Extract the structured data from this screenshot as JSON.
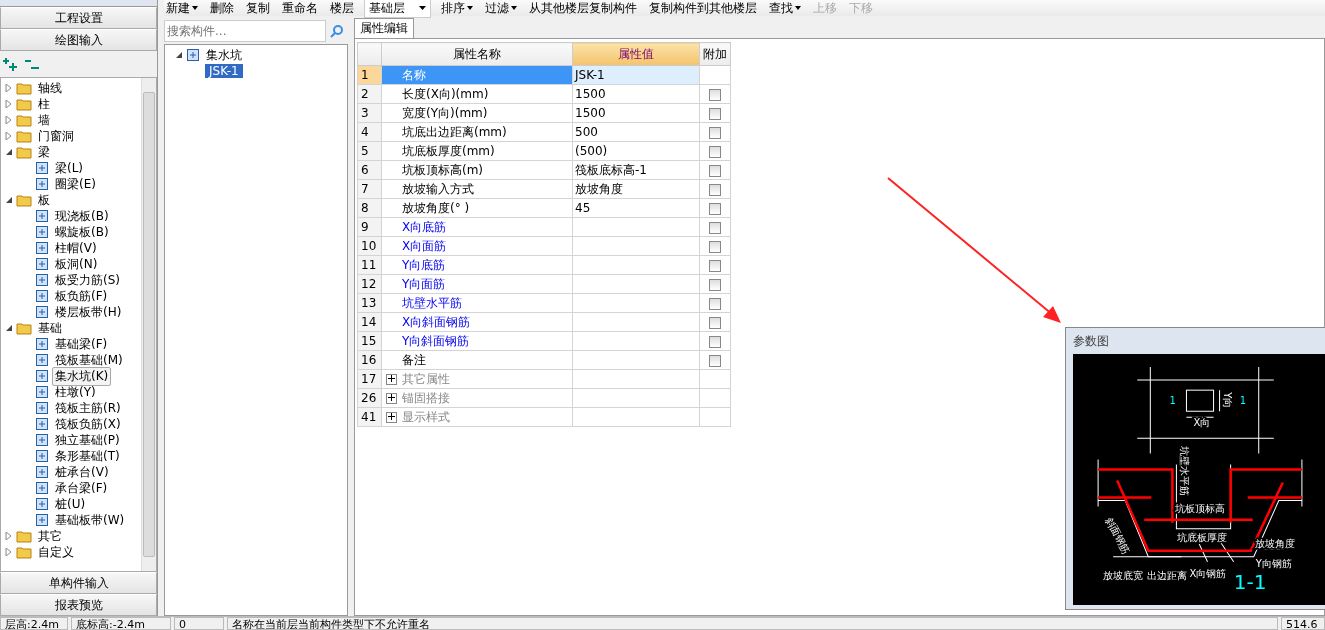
{
  "toolbar": [
    {
      "kind": "button",
      "label": "新建",
      "caret": true,
      "disabled": false
    },
    {
      "kind": "button",
      "label": "删除",
      "caret": false,
      "disabled": false
    },
    {
      "kind": "button",
      "label": "复制",
      "caret": false,
      "disabled": false
    },
    {
      "kind": "button",
      "label": "重命名",
      "caret": false,
      "disabled": false
    },
    {
      "kind": "select",
      "label": "楼层",
      "value": "基础层"
    },
    {
      "kind": "button",
      "label": "排序",
      "caret": true,
      "disabled": false
    },
    {
      "kind": "button",
      "label": "过滤",
      "caret": true,
      "disabled": false
    },
    {
      "kind": "button",
      "label": "从其他楼层复制构件",
      "caret": false,
      "disabled": false
    },
    {
      "kind": "button",
      "label": "复制构件到其他楼层",
      "caret": false,
      "disabled": false
    },
    {
      "kind": "button",
      "label": "查找",
      "caret": true,
      "disabled": false
    },
    {
      "kind": "button",
      "label": "上移",
      "caret": false,
      "disabled": true
    },
    {
      "kind": "button",
      "label": "下移",
      "caret": false,
      "disabled": true
    }
  ],
  "nav": {
    "top_buttons": [
      "工程设置",
      "绘图输入"
    ],
    "tree": [
      {
        "label": "轴线",
        "expanded": false
      },
      {
        "label": "柱",
        "expanded": false
      },
      {
        "label": "墙",
        "expanded": false
      },
      {
        "label": "门窗洞",
        "expanded": false
      },
      {
        "label": "梁",
        "expanded": true,
        "children": [
          {
            "label": "梁(L)",
            "selected": false
          },
          {
            "label": "圈梁(E)",
            "selected": false
          }
        ]
      },
      {
        "label": "板",
        "expanded": true,
        "children": [
          {
            "label": "现浇板(B)",
            "selected": false
          },
          {
            "label": "螺旋板(B)",
            "selected": false
          },
          {
            "label": "柱帽(V)",
            "selected": false
          },
          {
            "label": "板洞(N)",
            "selected": false
          },
          {
            "label": "板受力筋(S)",
            "selected": false
          },
          {
            "label": "板负筋(F)",
            "selected": false
          },
          {
            "label": "楼层板带(H)",
            "selected": false
          }
        ]
      },
      {
        "label": "基础",
        "expanded": true,
        "children": [
          {
            "label": "基础梁(F)",
            "selected": false
          },
          {
            "label": "筏板基础(M)",
            "selected": false
          },
          {
            "label": "集水坑(K)",
            "selected": true
          },
          {
            "label": "柱墩(Y)",
            "selected": false
          },
          {
            "label": "筏板主筋(R)",
            "selected": false
          },
          {
            "label": "筏板负筋(X)",
            "selected": false
          },
          {
            "label": "独立基础(P)",
            "selected": false
          },
          {
            "label": "条形基础(T)",
            "selected": false
          },
          {
            "label": "桩承台(V)",
            "selected": false
          },
          {
            "label": "承台梁(F)",
            "selected": false
          },
          {
            "label": "桩(U)",
            "selected": false
          },
          {
            "label": "基础板带(W)",
            "selected": false
          }
        ]
      },
      {
        "label": "其它",
        "expanded": false
      },
      {
        "label": "自定义",
        "expanded": false
      }
    ],
    "bottom_buttons": [
      "单构件输入",
      "报表预览"
    ]
  },
  "components": {
    "search": {
      "placeholder": "搜索构件..."
    },
    "tree": [
      {
        "label": "集水坑",
        "expanded": true,
        "children": [
          {
            "label": "JSK-1",
            "selected": true
          }
        ]
      }
    ]
  },
  "properties": {
    "tab": {
      "label": "属性编辑",
      "selected": true
    },
    "columns": [
      "属性名称",
      "属性值",
      "附加"
    ],
    "rows": [
      {
        "num": "1",
        "name": "名称",
        "value": "JSK-1",
        "kind": "basic",
        "selected": true
      },
      {
        "num": "2",
        "name": "长度(X向)(mm)",
        "value": "1500",
        "kind": "basic",
        "selected": false,
        "checked": false
      },
      {
        "num": "3",
        "name": "宽度(Y向)(mm)",
        "value": "1500",
        "kind": "basic",
        "selected": false,
        "checked": false
      },
      {
        "num": "4",
        "name": "坑底出边距离(mm)",
        "value": "500",
        "kind": "basic",
        "selected": false,
        "checked": false
      },
      {
        "num": "5",
        "name": "坑底板厚度(mm)",
        "value": "(500)",
        "kind": "basic",
        "selected": false,
        "checked": false
      },
      {
        "num": "6",
        "name": "坑板顶标高(m)",
        "value": "筏板底标高-1",
        "kind": "basic",
        "selected": false,
        "checked": false
      },
      {
        "num": "7",
        "name": "放坡输入方式",
        "value": "放坡角度",
        "kind": "basic",
        "selected": false,
        "checked": false
      },
      {
        "num": "8",
        "name": "放坡角度(° )",
        "value": "45",
        "kind": "basic",
        "selected": false,
        "checked": false
      },
      {
        "num": "9",
        "name": "X向底筋",
        "kind": "rebar",
        "selected": false,
        "checked": false
      },
      {
        "num": "10",
        "name": "X向面筋",
        "kind": "rebar",
        "selected": false,
        "checked": false
      },
      {
        "num": "11",
        "name": "Y向底筋",
        "kind": "rebar",
        "selected": false,
        "checked": false
      },
      {
        "num": "12",
        "name": "Y向面筋",
        "kind": "rebar",
        "selected": false,
        "checked": false
      },
      {
        "num": "13",
        "name": "坑壁水平筋",
        "kind": "rebar",
        "selected": false,
        "checked": false
      },
      {
        "num": "14",
        "name": "X向斜面钢筋",
        "kind": "rebar",
        "selected": false,
        "checked": false
      },
      {
        "num": "15",
        "name": "Y向斜面钢筋",
        "kind": "rebar",
        "selected": false,
        "checked": false
      },
      {
        "num": "16",
        "name": "备注",
        "kind": "basic",
        "selected": false,
        "checked": false
      },
      {
        "num": "17",
        "name": "其它属性",
        "kind": "group",
        "selected": false
      },
      {
        "num": "26",
        "name": "锚固搭接",
        "kind": "group",
        "selected": false
      },
      {
        "num": "41",
        "name": "显示样式",
        "kind": "group",
        "selected": false
      }
    ]
  },
  "param_panel": {
    "title": "参数图",
    "labels": [
      "1",
      "1",
      "Y向",
      "X向",
      "坑壁水平筋",
      "坑板顶标高",
      "坑底板厚度",
      "放坡角度",
      "Y向钢筋",
      "放坡底宽",
      "出边距离",
      "X向钢筋",
      "斜面钢筋",
      "1-1"
    ]
  },
  "status_bar": [
    "层高:2.4m",
    "底标高:-2.4m",
    "0",
    "名称在当前层当前构件类型下不允许重名",
    "514.6"
  ]
}
